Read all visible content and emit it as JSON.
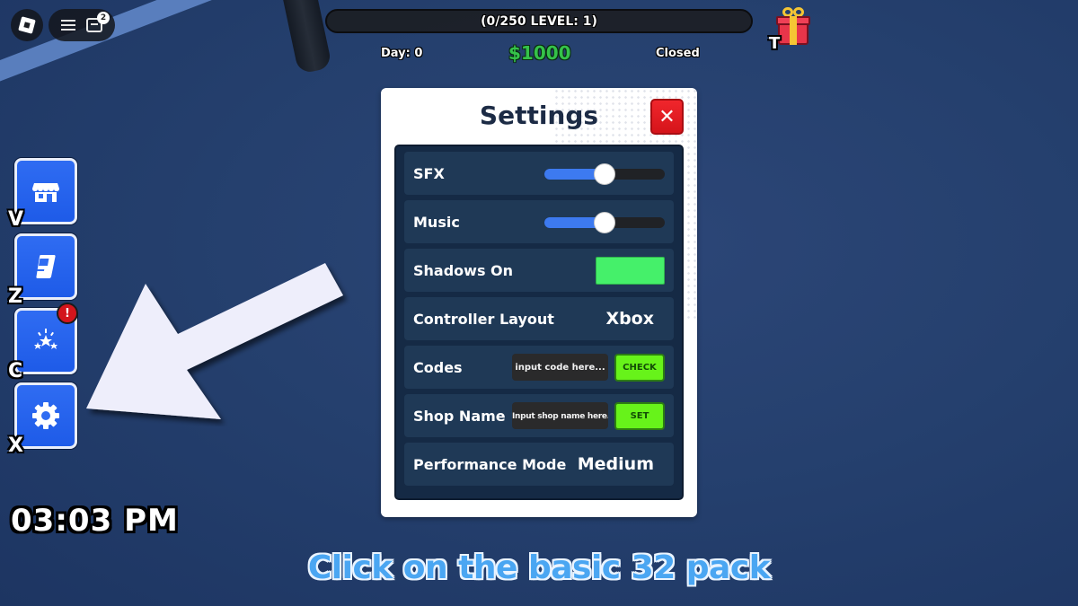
{
  "topbar": {
    "chat_unread_count": "2"
  },
  "hud": {
    "level_text": "(0/250 LEVEL: 1)",
    "day_text": "Day: 0",
    "money_text": "$1000",
    "shop_status": "Closed",
    "gift_key": "T"
  },
  "sidebar": {
    "items": [
      {
        "name": "shop",
        "icon": "shop-icon",
        "key": "V"
      },
      {
        "name": "book",
        "icon": "book-icon",
        "key": "Z"
      },
      {
        "name": "rewards",
        "icon": "sparkle-stars-icon",
        "key": "C",
        "badge": "!"
      },
      {
        "name": "settings",
        "icon": "gear-icon",
        "key": "X"
      }
    ]
  },
  "clock": "03:03 PM",
  "settings": {
    "title": "Settings",
    "close_label": "✕",
    "rows": {
      "sfx": {
        "label": "SFX",
        "value_percent": 50
      },
      "music": {
        "label": "Music",
        "value_percent": 50
      },
      "shadows": {
        "label": "Shadows On",
        "enabled": true
      },
      "controller": {
        "label": "Controller Layout",
        "value": "Xbox"
      },
      "codes": {
        "label": "Codes",
        "placeholder": "input code here...",
        "button": "CHECK"
      },
      "shop_name": {
        "label": "Shop Name",
        "placeholder": "Input shop name here...",
        "button": "SET"
      },
      "performance": {
        "label": "Performance Mode",
        "value": "Medium"
      }
    }
  },
  "instruction_caption": "Click on the basic 32 pack",
  "colors": {
    "accent_blue": "#2f6cf2",
    "money_green": "#35c24a",
    "close_red": "#e01d23",
    "toggle_green": "#45f06a",
    "action_green": "#67f31a",
    "caption_blue": "#4aa6f2"
  }
}
